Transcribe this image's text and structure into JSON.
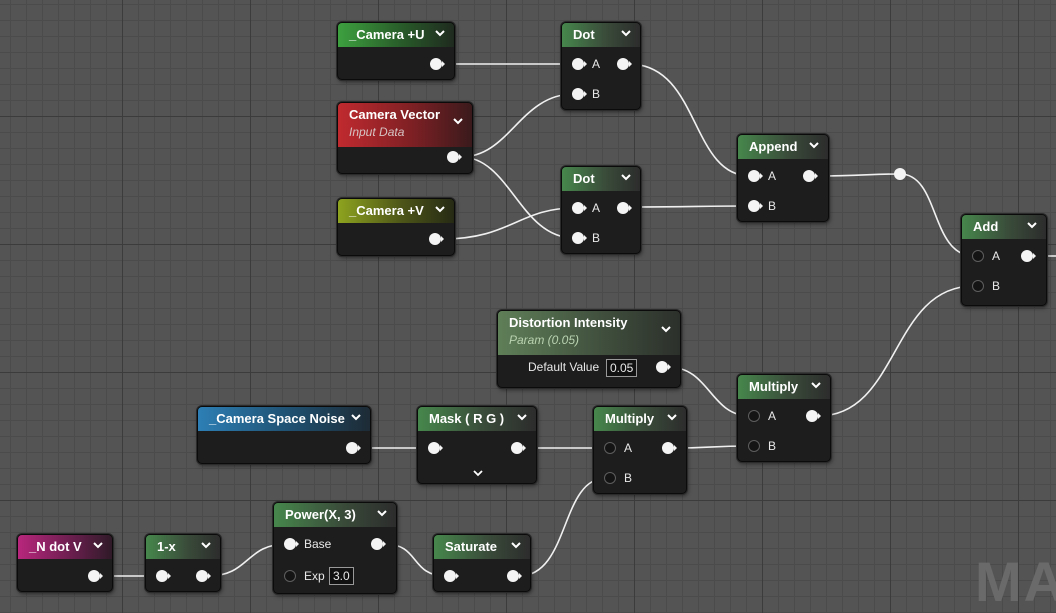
{
  "watermark": "MA",
  "nodes": {
    "camera_u": {
      "title": "_Camera +U"
    },
    "camera_vector": {
      "title": "Camera Vector",
      "subtitle": "Input Data"
    },
    "camera_v": {
      "title": "_Camera +V"
    },
    "dot1": {
      "title": "Dot",
      "pins": {
        "a": "A",
        "b": "B"
      }
    },
    "dot2": {
      "title": "Dot",
      "pins": {
        "a": "A",
        "b": "B"
      }
    },
    "append": {
      "title": "Append",
      "pins": {
        "a": "A",
        "b": "B"
      }
    },
    "add": {
      "title": "Add",
      "pins": {
        "a": "A",
        "b": "B"
      }
    },
    "distortion": {
      "title": "Distortion Intensity",
      "subtitle": "Param (0.05)",
      "default_label": "Default Value",
      "default_value": "0.05"
    },
    "multiply_top": {
      "title": "Multiply",
      "pins": {
        "a": "A",
        "b": "B"
      }
    },
    "noise": {
      "title": "_Camera Space Noise"
    },
    "mask": {
      "title": "Mask ( R G )"
    },
    "multiply_low": {
      "title": "Multiply",
      "pins": {
        "a": "A",
        "b": "B"
      }
    },
    "ndotv": {
      "title": "_N dot V"
    },
    "oneminus": {
      "title": "1-x"
    },
    "power": {
      "title": "Power(X, 3)",
      "base_label": "Base",
      "exp_label": "Exp",
      "exp_value": "3.0"
    },
    "saturate": {
      "title": "Saturate"
    }
  },
  "colors": {
    "wire": "#f2f2f2",
    "grid_bg": "#545454"
  }
}
